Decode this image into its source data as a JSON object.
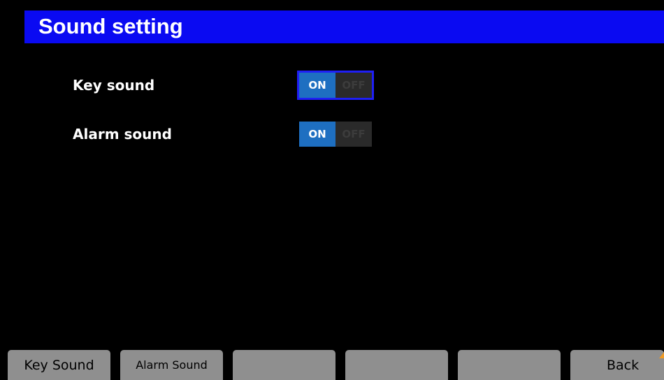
{
  "header": {
    "title": "Sound setting"
  },
  "settings": [
    {
      "label": "Key sound",
      "on_label": "ON",
      "off_label": "OFF",
      "value": "ON",
      "focused": true
    },
    {
      "label": "Alarm sound",
      "on_label": "ON",
      "off_label": "OFF",
      "value": "ON",
      "focused": false
    }
  ],
  "softkeys": [
    {
      "label": "Key Sound"
    },
    {
      "label": "Alarm Sound"
    },
    {
      "label": ""
    },
    {
      "label": ""
    },
    {
      "label": ""
    },
    {
      "label": "Back"
    }
  ],
  "colors": {
    "title_bar": "#0a0af2",
    "toggle_on": "#1e6fc1",
    "toggle_off": "#2a2a2a",
    "softkey": "#8f8f8f",
    "focus_border": "#1f1ff5",
    "back_arrow": "#f09a24"
  }
}
